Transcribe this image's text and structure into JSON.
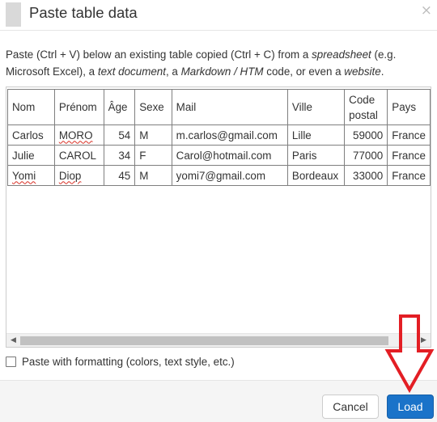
{
  "dialog": {
    "title": "Paste table data",
    "close_glyph": "×"
  },
  "instructions": {
    "t1": "Paste (Ctrl + V) below an existing table copied (Ctrl + C) from a ",
    "e1": "spreadsheet",
    "t2": " (e.g. Microsoft Excel), a ",
    "e2": "text document",
    "t3": ", a ",
    "e3": "Markdown / HTM",
    "t4": " code, or even a ",
    "e4": "website",
    "t5": "."
  },
  "table": {
    "headers": [
      "Nom",
      "Prénom",
      "Âge",
      "Sexe",
      "Mail",
      "Ville",
      "Code postal",
      "Pays"
    ],
    "rows": [
      [
        "Carlos",
        "MORO",
        "54",
        "M",
        "m.carlos@gmail.com",
        "Lille",
        "59000",
        "France"
      ],
      [
        "Julie",
        "CAROL",
        "34",
        "F",
        "Carol@hotmail.com",
        "Paris",
        "77000",
        "France"
      ],
      [
        "Yomi",
        "Diop",
        "45",
        "M",
        "yomi7@gmail.com",
        "Bordeaux",
        "33000",
        "France"
      ]
    ]
  },
  "scrollbar": {
    "left_glyph": "◀",
    "right_glyph": "▶"
  },
  "options": {
    "paste_formatting_label": "Paste with formatting (colors, text style, etc.)",
    "paste_formatting_checked": false
  },
  "footer": {
    "cancel_label": "Cancel",
    "load_label": "Load"
  },
  "colors": {
    "primary": "#1a73c9",
    "annotation": "#e31e24"
  }
}
